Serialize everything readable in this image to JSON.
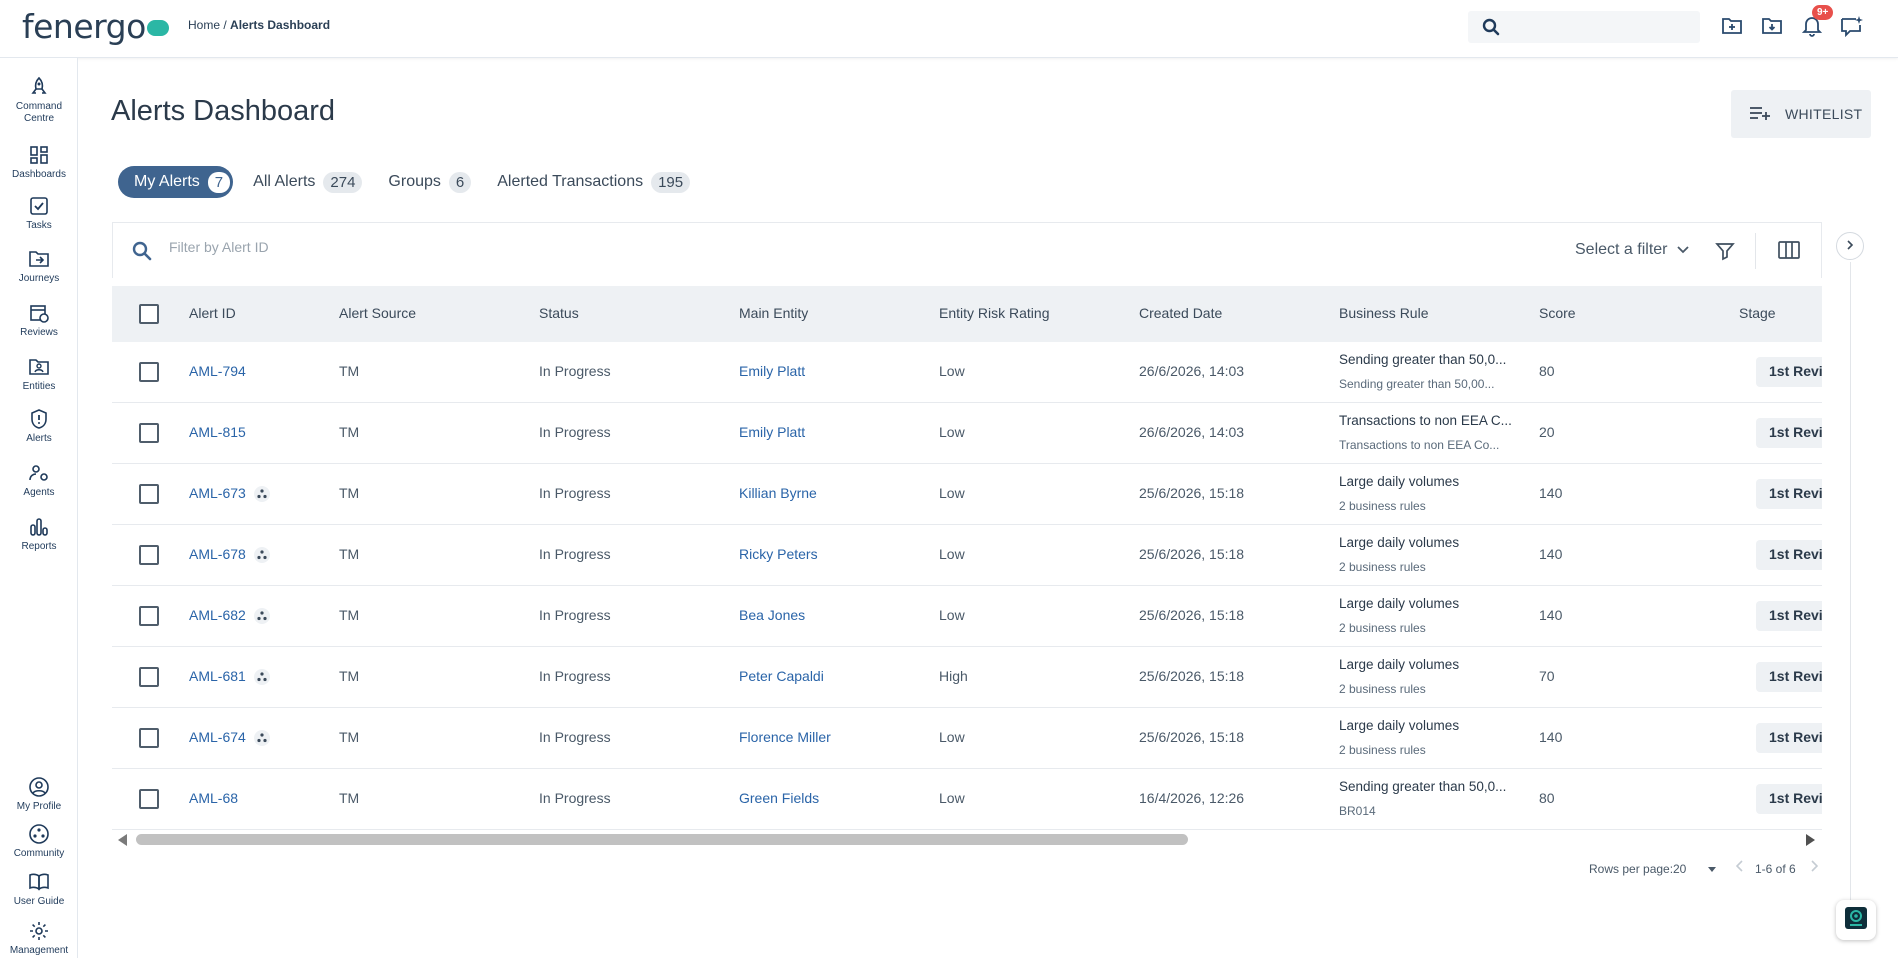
{
  "app": {
    "logo_text": "fenerg",
    "logo_tail": "o"
  },
  "breadcrumb": {
    "home": "Home",
    "separator": " / ",
    "current": "Alerts Dashboard"
  },
  "header": {
    "notification_badge": "9+"
  },
  "sidebar": {
    "items": [
      {
        "label": "Command Centre",
        "icon": "rocket-icon"
      },
      {
        "label": "Dashboards",
        "icon": "dashboard-grid-icon"
      },
      {
        "label": "Tasks",
        "icon": "task-check-icon"
      },
      {
        "label": "Journeys",
        "icon": "folder-arrow-icon"
      },
      {
        "label": "Reviews",
        "icon": "calendar-clock-icon"
      },
      {
        "label": "Entities",
        "icon": "person-folder-icon"
      },
      {
        "label": "Alerts",
        "icon": "shield-alert-icon"
      },
      {
        "label": "Agents",
        "icon": "agents-gear-icon"
      },
      {
        "label": "Reports",
        "icon": "bar-chart-icon"
      }
    ],
    "bottom": [
      {
        "label": "My Profile",
        "icon": "profile-icon"
      },
      {
        "label": "Community",
        "icon": "community-icon"
      },
      {
        "label": "User Guide",
        "icon": "book-icon"
      },
      {
        "label": "Management",
        "icon": "gear-icon"
      }
    ]
  },
  "page": {
    "title": "Alerts Dashboard",
    "whitelist_label": "WHITELIST"
  },
  "tabs": [
    {
      "label": "My Alerts",
      "count": "7",
      "active": true
    },
    {
      "label": "All Alerts",
      "count": "274"
    },
    {
      "label": "Groups",
      "count": "6"
    },
    {
      "label": "Alerted Transactions",
      "count": "195"
    }
  ],
  "filter": {
    "placeholder": "Filter by Alert ID",
    "select_label": "Select a filter"
  },
  "table": {
    "columns": [
      "Alert ID",
      "Alert Source",
      "Status",
      "Main Entity",
      "Entity Risk Rating",
      "Created Date",
      "Business Rule",
      "Score",
      "Stage"
    ],
    "rows": [
      {
        "id": "AML-794",
        "group": false,
        "source": "TM",
        "status": "In Progress",
        "entity": "Emily Platt",
        "risk": "Low",
        "created": "26/6/2026, 14:03",
        "rule": "Sending greater than 50,0...",
        "rule_sub": "Sending greater than 50,00...",
        "score": "80",
        "stage": "1st Revi"
      },
      {
        "id": "AML-815",
        "group": false,
        "source": "TM",
        "status": "In Progress",
        "entity": "Emily Platt",
        "risk": "Low",
        "created": "26/6/2026, 14:03",
        "rule": "Transactions to non EEA C...",
        "rule_sub": "Transactions to non EEA Co...",
        "score": "20",
        "stage": "1st Revi"
      },
      {
        "id": "AML-673",
        "group": true,
        "source": "TM",
        "status": "In Progress",
        "entity": "Killian Byrne",
        "risk": "Low",
        "created": "25/6/2026, 15:18",
        "rule": "Large daily volumes",
        "rule_sub": "2 business rules",
        "score": "140",
        "stage": "1st Revi"
      },
      {
        "id": "AML-678",
        "group": true,
        "source": "TM",
        "status": "In Progress",
        "entity": "Ricky Peters",
        "risk": "Low",
        "created": "25/6/2026, 15:18",
        "rule": "Large daily volumes",
        "rule_sub": "2 business rules",
        "score": "140",
        "stage": "1st Revi"
      },
      {
        "id": "AML-682",
        "group": true,
        "source": "TM",
        "status": "In Progress",
        "entity": "Bea Jones",
        "risk": "Low",
        "created": "25/6/2026, 15:18",
        "rule": "Large daily volumes",
        "rule_sub": "2 business rules",
        "score": "140",
        "stage": "1st Revi"
      },
      {
        "id": "AML-681",
        "group": true,
        "source": "TM",
        "status": "In Progress",
        "entity": "Peter Capaldi",
        "risk": "High",
        "created": "25/6/2026, 15:18",
        "rule": "Large daily volumes",
        "rule_sub": "2 business rules",
        "score": "70",
        "stage": "1st Revi"
      },
      {
        "id": "AML-674",
        "group": true,
        "source": "TM",
        "status": "In Progress",
        "entity": "Florence Miller",
        "risk": "Low",
        "created": "25/6/2026, 15:18",
        "rule": "Large daily volumes",
        "rule_sub": "2 business rules",
        "score": "140",
        "stage": "1st Revi"
      },
      {
        "id": "AML-68",
        "group": false,
        "source": "TM",
        "status": "In Progress",
        "entity": "Green Fields",
        "risk": "Low",
        "created": "16/4/2026, 12:26",
        "rule": "Sending greater than 50,0...",
        "rule_sub": "BR014",
        "score": "80",
        "stage": "1st Revi"
      }
    ]
  },
  "pagination": {
    "rows_per_page_label": "Rows per page:",
    "rows_per_page_value": "20",
    "range": "1-6 of 6"
  },
  "colors": {
    "accent": "#3f648f",
    "link": "#2a64a8",
    "brand_teal": "#2bb7a5",
    "badge": "#e8504b"
  }
}
